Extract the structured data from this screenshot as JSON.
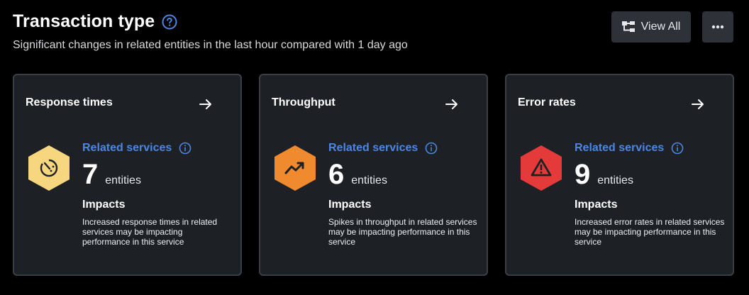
{
  "header": {
    "title": "Transaction type",
    "subtitle": "Significant changes in related entities in the last hour compared with 1 day ago",
    "help_icon": "question-circle-icon"
  },
  "actions": {
    "view_all_label": "View All",
    "view_all_icon": "hierarchy-icon",
    "more_icon": "more-horizontal-icon"
  },
  "cards": [
    {
      "title": "Response times",
      "icon": "clock-timer-icon",
      "icon_color": "#f6d67e",
      "related_label": "Related services",
      "count": "7",
      "unit": "entities",
      "impacts_label": "Impacts",
      "description": "Increased response times in related services may be impacting performance in this service"
    },
    {
      "title": "Throughput",
      "icon": "trend-up-icon",
      "icon_color": "#f08a2e",
      "related_label": "Related services",
      "count": "6",
      "unit": "entities",
      "impacts_label": "Impacts",
      "description": "Spikes in throughput in related services may be impacting performance in this service"
    },
    {
      "title": "Error rates",
      "icon": "warning-triangle-icon",
      "icon_color": "#e53a3a",
      "related_label": "Related services",
      "count": "9",
      "unit": "entities",
      "impacts_label": "Impacts",
      "description": "Increased error rates in related services may be impacting performance in this service"
    }
  ],
  "colors": {
    "background": "#000000",
    "card_background": "#1d2126",
    "card_border": "#3a3f46",
    "link": "#4d86e0"
  }
}
